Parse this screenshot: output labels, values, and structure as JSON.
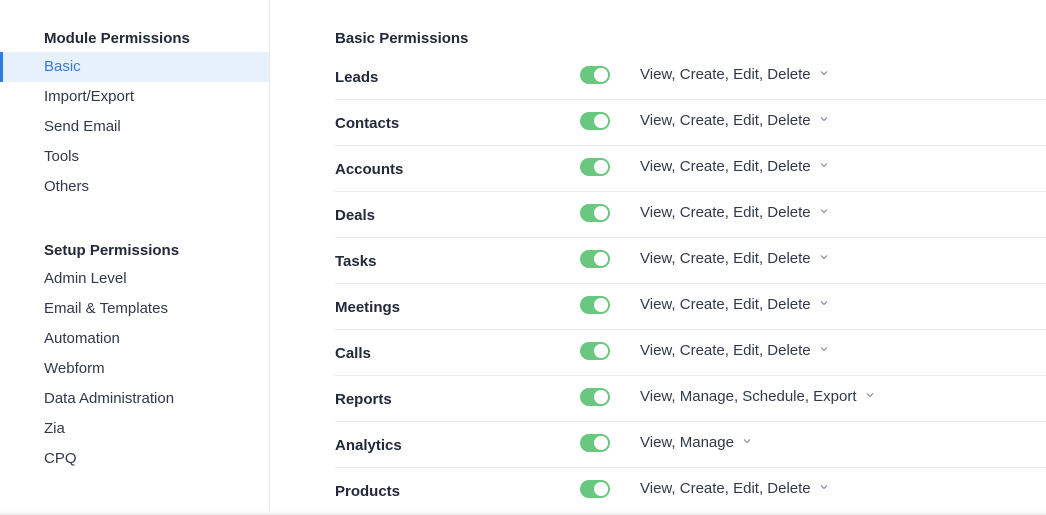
{
  "sidebar": {
    "module_heading": "Module Permissions",
    "module_items": [
      {
        "label": "Basic",
        "active": true
      },
      {
        "label": "Import/Export"
      },
      {
        "label": "Send Email"
      },
      {
        "label": "Tools"
      },
      {
        "label": "Others"
      }
    ],
    "setup_heading": "Setup Permissions",
    "setup_items": [
      {
        "label": "Admin Level"
      },
      {
        "label": "Email & Templates"
      },
      {
        "label": "Automation"
      },
      {
        "label": "Webform"
      },
      {
        "label": "Data Administration"
      },
      {
        "label": "Zia"
      },
      {
        "label": "CPQ"
      }
    ]
  },
  "main": {
    "title": "Basic Permissions",
    "permissions": [
      {
        "module": "Leads",
        "enabled": true,
        "access": "View, Create, Edit, Delete"
      },
      {
        "module": "Contacts",
        "enabled": true,
        "access": "View, Create, Edit, Delete"
      },
      {
        "module": "Accounts",
        "enabled": true,
        "access": "View, Create, Edit, Delete"
      },
      {
        "module": "Deals",
        "enabled": true,
        "access": "View, Create, Edit, Delete"
      },
      {
        "module": "Tasks",
        "enabled": true,
        "access": "View, Create, Edit, Delete"
      },
      {
        "module": "Meetings",
        "enabled": true,
        "access": "View, Create, Edit, Delete"
      },
      {
        "module": "Calls",
        "enabled": true,
        "access": "View, Create, Edit, Delete"
      },
      {
        "module": "Reports",
        "enabled": true,
        "access": "View, Manage, Schedule, Export"
      },
      {
        "module": "Analytics",
        "enabled": true,
        "access": "View, Manage"
      },
      {
        "module": "Products",
        "enabled": true,
        "access": "View, Create, Edit, Delete"
      }
    ]
  },
  "colors": {
    "accent": "#2f7ee0",
    "active_bg": "#e6f1fc",
    "toggle_on": "#6ac77f"
  }
}
